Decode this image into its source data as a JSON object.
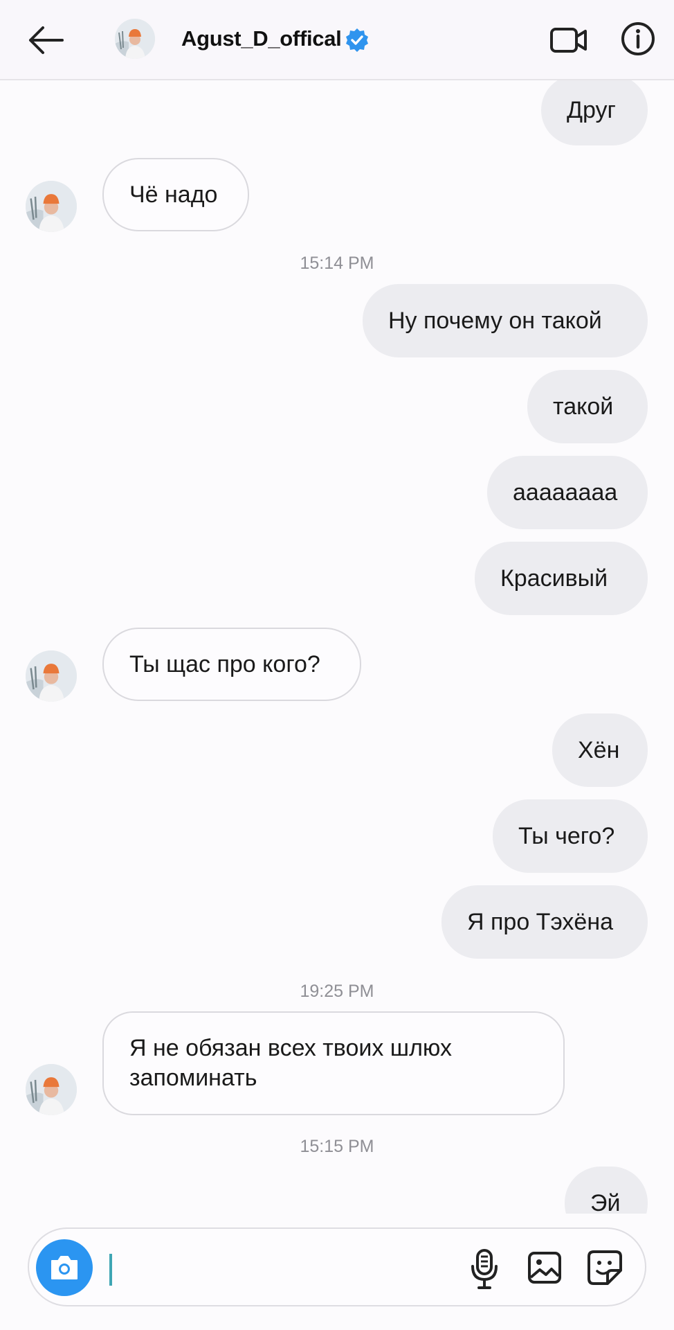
{
  "header": {
    "title": "Agust_D_offical",
    "verified_icon": "verified-badge-icon",
    "back_icon": "back-arrow-icon",
    "video_icon": "video-call-icon",
    "info_icon": "info-icon",
    "accent_color": "#2f94ee"
  },
  "messages": [
    {
      "side": "sent",
      "text": "Друг"
    },
    {
      "side": "received",
      "text": "Чё надо"
    },
    {
      "timestamp": "15:14 PM"
    },
    {
      "side": "sent",
      "text": "Ну почему он такой"
    },
    {
      "side": "sent",
      "text": "такой"
    },
    {
      "side": "sent",
      "text": "аааaaaaa"
    },
    {
      "side": "sent",
      "text": "Красивый"
    },
    {
      "side": "received",
      "text": "Ты щас про кого?"
    },
    {
      "side": "sent",
      "text": "Хён"
    },
    {
      "side": "sent",
      "text": "Ты чего?"
    },
    {
      "side": "sent",
      "text": "Я про Тэхёна"
    },
    {
      "timestamp": "19:25 PM"
    },
    {
      "side": "received",
      "text": "Я не обязан всех твоих шлюх запоминать"
    },
    {
      "timestamp": "15:15 PM"
    },
    {
      "side": "sent",
      "text": "Эй"
    }
  ],
  "composer": {
    "value": "",
    "placeholder": "",
    "camera_icon": "camera-icon",
    "mic_icon": "microphone-icon",
    "gallery_icon": "gallery-icon",
    "sticker_icon": "sticker-icon",
    "camera_color": "#2b95f1"
  }
}
